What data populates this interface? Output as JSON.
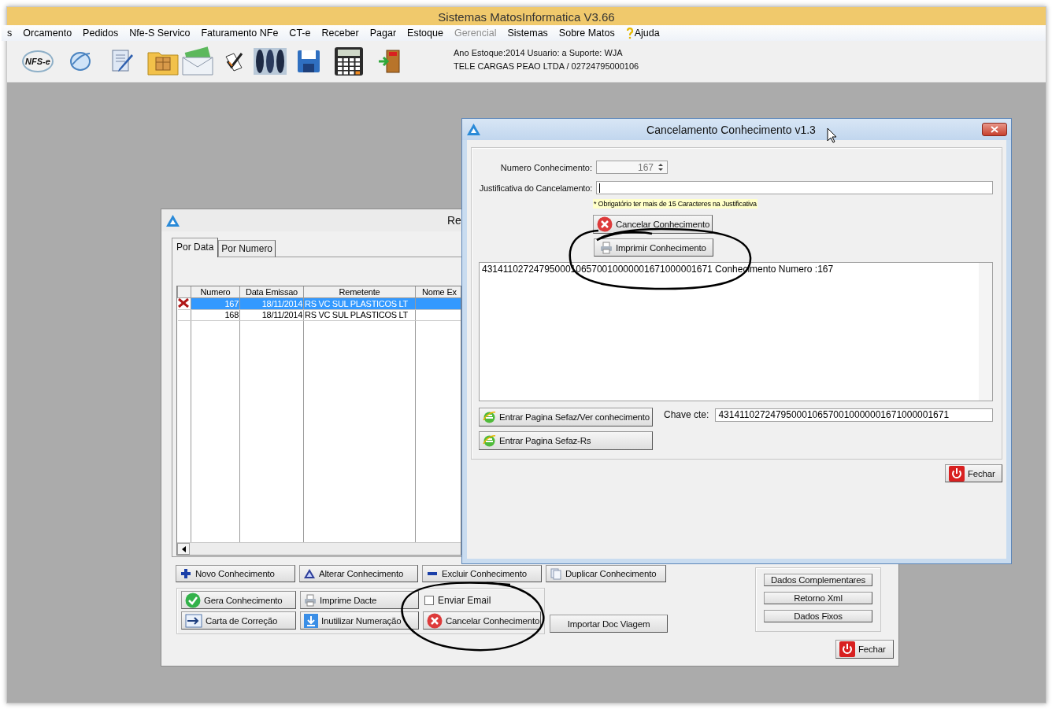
{
  "app": {
    "title": "Sistemas MatosInformatica V3.66",
    "menu": [
      {
        "label": "s",
        "disabled": false
      },
      {
        "label": "Orcamento",
        "disabled": false
      },
      {
        "label": "Pedidos",
        "disabled": false
      },
      {
        "label": "Nfe-S Servico",
        "disabled": false
      },
      {
        "label": "Faturamento NFe",
        "disabled": false
      },
      {
        "label": "CT-e",
        "disabled": false
      },
      {
        "label": "Receber",
        "disabled": false
      },
      {
        "label": "Pagar",
        "disabled": false
      },
      {
        "label": "Estoque",
        "disabled": false
      },
      {
        "label": "Gerencial",
        "disabled": true
      },
      {
        "label": "Sistemas",
        "disabled": false
      },
      {
        "label": "Sobre Matos",
        "disabled": false
      },
      {
        "label": "Ajuda",
        "disabled": false,
        "kind": "help"
      }
    ],
    "toolbar_logo": "NFS-e",
    "info": [
      "Ano Estoque:2014 Usuario: a Suporte: WJA",
      "TELE CARGAS PEAO LTDA / 02724795000106"
    ]
  },
  "list_window": {
    "title": "Re",
    "tabs": [
      {
        "label": "Por Data",
        "selected": true
      },
      {
        "label": "Por Numero",
        "selected": false
      }
    ],
    "table": {
      "columns": [
        "Numero",
        "Data Emissao",
        "Remetente",
        "Nome Ex"
      ],
      "rows": [
        {
          "cells": [
            "167",
            "18/11/2014",
            "RS VC SUL PLASTICOS LT"
          ],
          "selected": true,
          "marked": true
        },
        {
          "cells": [
            "168",
            "18/11/2014",
            "RS VC SUL PLASTICOS LT"
          ],
          "selected": false,
          "marked": false
        }
      ]
    },
    "action_buttons": [
      "Novo Conhecimento",
      "Alterar Conhecimento",
      "Excluir Conhecimento",
      "Duplicar Conhecimento"
    ],
    "group_buttons": [
      "Gera Conhecimento",
      "Imprime Dacte",
      "Carta de Correção",
      "Inutilizar Numeração",
      "Cancelar Conhecimento"
    ],
    "email_checkbox": {
      "label": "Enviar Email",
      "checked": false
    },
    "import_button": "Importar Doc Viagem",
    "side_buttons": [
      "Dados Complementares",
      "Retorno Xml",
      "Dados Fixos"
    ],
    "close_button": "Fechar"
  },
  "cancel_dialog": {
    "title": "Cancelamento Conhecimento v1.3",
    "numero_label": "Numero Conhecimento:",
    "numero": {
      "value": "167",
      "disabled": true
    },
    "justificativa_label": "Justificativa do Cancelamento:",
    "note": "* Obrigatório ter mais de 15 Caracteres na Justificativa",
    "buttons": [
      "Cancelar Conhecimento",
      "Imprimir Conhecimento"
    ],
    "log": "43141102724795000106570010000001671000001671 Conhecimento Numero :167",
    "sefaz_buttons": [
      "Entrar Pagina Sefaz/Ver conhecimento",
      "Entrar Pagina Sefaz-Rs"
    ],
    "chave_label": "Chave cte:",
    "chave": "43141102724795000106570010000001671000001671",
    "close_button": "Fechar"
  }
}
